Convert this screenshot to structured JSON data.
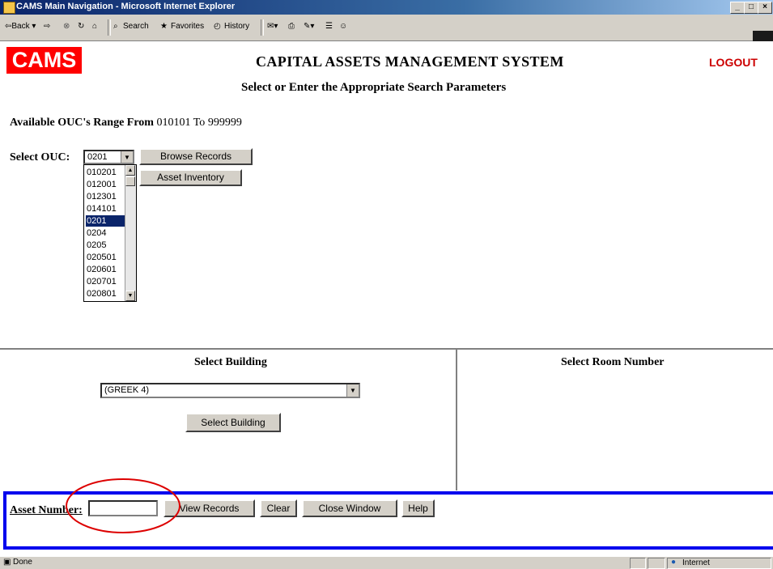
{
  "window": {
    "title": "CAMS Main Navigation - Microsoft Internet Explorer",
    "controls": [
      "_",
      "□",
      "×"
    ]
  },
  "toolbar": {
    "back": "⇦Back ▾",
    "forward": "⇨",
    "search": "Search",
    "favorites": "Favorites",
    "history": "History"
  },
  "header": {
    "logo": "CAMS",
    "title": "CAPITAL ASSETS MANAGEMENT SYSTEM",
    "logout": "LOGOUT",
    "subtitle": "Select or Enter the Appropriate Search Parameters"
  },
  "ouc": {
    "range_label": "Available OUC's Range From",
    "range_from": "010101",
    "range_to_label": "To",
    "range_to": "999999",
    "select_label": "Select OUC:",
    "selected": "0201",
    "options": [
      "010201",
      "012001",
      "012301",
      "014101",
      "0201",
      "0204",
      "0205",
      "020501",
      "020601",
      "020701",
      "020801"
    ],
    "browse_label": "Browse Records",
    "inventory_label": "Asset Inventory"
  },
  "building": {
    "heading": "Select Building",
    "selected": "(GREEK 4)",
    "button_label": "Select Building"
  },
  "room": {
    "heading": "Select Room Number"
  },
  "asset": {
    "label": "Asset Number:",
    "value": "",
    "view_label": "View Records",
    "clear_label": "Clear",
    "close_label": "Close Window",
    "help_label": "Help"
  },
  "status": {
    "text": "Done",
    "zone": "Internet"
  },
  "colors": {
    "logo_bg": "#ff0000",
    "logout": "#cc0000",
    "frame_border": "#0000ee",
    "annotation": "#dd0000",
    "selection": "#0a246a"
  }
}
